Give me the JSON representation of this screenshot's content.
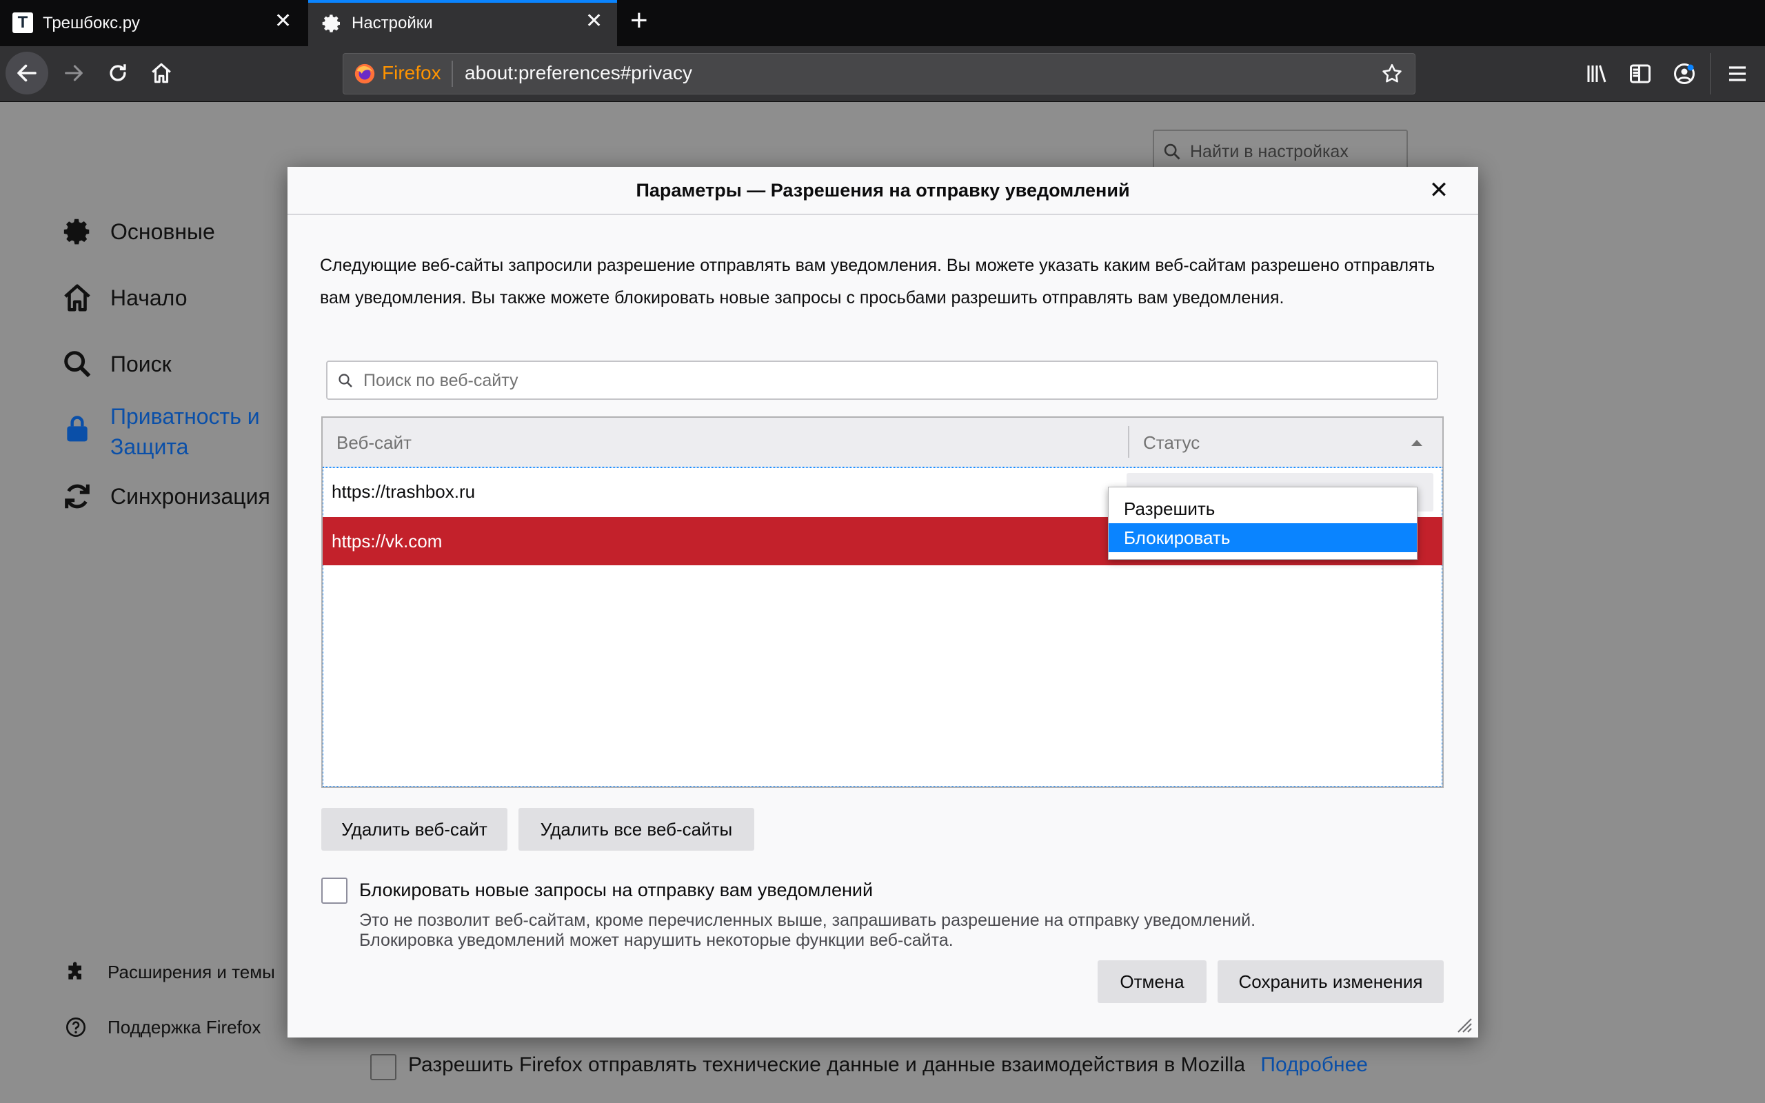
{
  "tabs": [
    {
      "title": "Трешбокс.ру",
      "icon": "trashbox-favicon-icon",
      "active": false
    },
    {
      "title": "Настройки",
      "icon": "gear-icon",
      "active": true
    }
  ],
  "navbar": {
    "identity_label": "Firefox",
    "url": "about:preferences#privacy"
  },
  "prefs": {
    "search_placeholder": "Найти в настройках",
    "categories": [
      {
        "label": "Основные",
        "icon": "gear-icon"
      },
      {
        "label": "Начало",
        "icon": "home-icon"
      },
      {
        "label": "Поиск",
        "icon": "search-icon"
      },
      {
        "label_line1": "Приватность и",
        "label_line2": "Защита",
        "icon": "lock-icon",
        "selected": true
      },
      {
        "label": "Синхронизация",
        "icon": "sync-icon"
      }
    ],
    "footer_links": [
      {
        "label": "Расширения и темы",
        "icon": "puzzle-icon"
      },
      {
        "label": "Поддержка Firefox",
        "icon": "help-icon"
      }
    ],
    "telemetry_label": "Разрешить Firefox отправлять технические данные и данные взаимодействия в Mozilla",
    "telemetry_link": "Подробнее"
  },
  "dialog": {
    "title": "Параметры — Разрешения на отправку уведомлений",
    "description": "Следующие веб-сайты запросили разрешение отправлять вам уведомления. Вы можете указать каким веб-сайтам разрешено отправлять вам уведомления. Вы также можете блокировать новые запросы с просьбами разрешить отправлять вам уведомления.",
    "search_placeholder": "Поиск по веб-сайту",
    "columns": {
      "site": "Веб-сайт",
      "status": "Статус"
    },
    "rows": [
      {
        "site": "https://trashbox.ru",
        "selected": false
      },
      {
        "site": "https://vk.com",
        "selected": true
      }
    ],
    "status_options": [
      "Разрешить",
      "Блокировать"
    ],
    "status_selected": "Блокировать",
    "remove_site_button": "Удалить веб-сайт",
    "remove_all_button": "Удалить все веб-сайты",
    "block_checkbox_label": "Блокировать новые запросы на отправку вам уведомлений",
    "block_help_line1": "Это не позволит веб-сайтам, кроме перечисленных выше, запрашивать разрешение на отправку уведомлений.",
    "block_help_line2": "Блокировка уведомлений может нарушить некоторые функции веб-сайта.",
    "cancel_button": "Отмена",
    "save_button": "Сохранить изменения"
  },
  "colors": {
    "accent": "#0a84ff",
    "selected_row": "#c3212b",
    "firefox_orange": "#ff9400",
    "link": "#0060df"
  }
}
